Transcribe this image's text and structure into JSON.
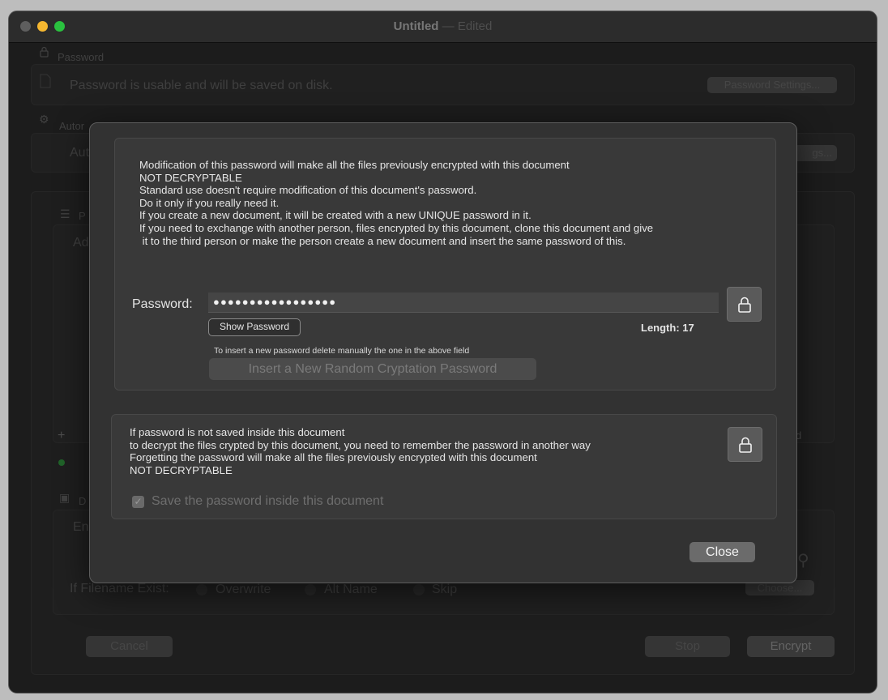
{
  "window": {
    "title": "Untitled",
    "separator": "—",
    "status": "Edited"
  },
  "background": {
    "password_section": {
      "label": "Password",
      "message": "Password is usable and will be saved on disk.",
      "settings_button": "Password Settings..."
    },
    "auto_section": {
      "label": "Autor",
      "row_text": "Aut",
      "settings_button": "gs..."
    },
    "list_section": {
      "label": "P",
      "row_text": "Ad",
      "add_button": "+",
      "right_fragment": "d"
    },
    "dest_section": {
      "label": "D",
      "row_text": "En",
      "filename_label": "If Filename Exist:",
      "options": [
        "Overwrite",
        "Alt Name",
        "Skip"
      ],
      "choose_button": "Choose..."
    },
    "footer": {
      "cancel": "Cancel",
      "stop": "Stop",
      "encrypt": "Encrypt"
    }
  },
  "dialog": {
    "warning_lines": [
      "Modification of this password will make all the files previously encrypted with this document",
      "NOT DECRYPTABLE",
      "Standard use doesn't require modification of this document's password.",
      "Do it only if you really need it.",
      "If you create a new document, it will be created with a new UNIQUE password in it.",
      "If you need to exchange with another person, files encrypted by this document, clone this document and give",
      " it to the third person or make the person create a new document and insert the same password of this."
    ],
    "password_label": "Password:",
    "password_value": "●●●●●●●●●●●●●●●●●",
    "show_password_button": "Show Password",
    "length_label": "Length:",
    "length_value": "17",
    "hint": "To insert a new password delete manually the one in the above field",
    "random_button": "Insert a New Random Cryptation Password",
    "save_lines": [
      "If password is not saved inside this document",
      "to decrypt the files crypted by this document, you need to remember the password in another way",
      "Forgetting the password will make all the files previously encrypted with this document",
      "NOT DECRYPTABLE"
    ],
    "save_checkbox_label": "Save the password inside this document",
    "close_button": "Close"
  }
}
